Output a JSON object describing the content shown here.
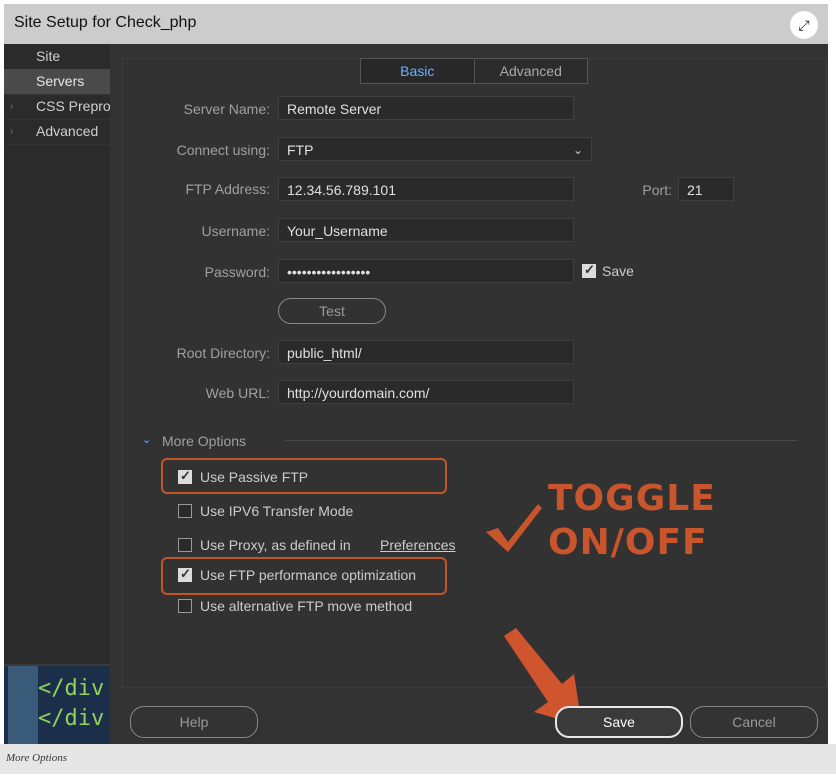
{
  "window": {
    "title": "Site Setup for Check_php"
  },
  "sidebar": {
    "items": [
      {
        "label": "Site",
        "active": false,
        "expandable": false
      },
      {
        "label": "Servers",
        "active": true,
        "expandable": false
      },
      {
        "label": "CSS Prepro",
        "active": false,
        "expandable": true
      },
      {
        "label": "Advanced",
        "active": false,
        "expandable": true
      }
    ]
  },
  "code_preview": {
    "lines": [
      "</div",
      "</div"
    ]
  },
  "tabs": [
    {
      "label": "Basic",
      "active": true
    },
    {
      "label": "Advanced",
      "active": false
    }
  ],
  "form": {
    "server_name": {
      "label": "Server Name:",
      "value": "Remote Server"
    },
    "connect_using": {
      "label": "Connect using:",
      "value": "FTP"
    },
    "ftp_address": {
      "label": "FTP Address:",
      "value": "12.34.56.789.101"
    },
    "port": {
      "label": "Port:",
      "value": "21"
    },
    "username": {
      "label": "Username:",
      "value": "Your_Username"
    },
    "password": {
      "label": "Password:",
      "value": "•••••••••••••••••"
    },
    "save_password": {
      "label": "Save",
      "checked": true
    },
    "test_button": "Test",
    "root_directory": {
      "label": "Root Directory:",
      "value": "public_html/"
    },
    "web_url": {
      "label": "Web URL:",
      "value": "http://yourdomain.com/"
    }
  },
  "more_options": {
    "label": "More Options",
    "options": [
      {
        "label": "Use Passive FTP",
        "checked": true,
        "highlighted": true
      },
      {
        "label": "Use IPV6 Transfer Mode",
        "checked": false,
        "highlighted": false
      },
      {
        "label": "Use Proxy, as defined in",
        "checked": false,
        "highlighted": false,
        "link": "Preferences"
      },
      {
        "label": "Use FTP performance optimization",
        "checked": true,
        "highlighted": true
      },
      {
        "label": "Use alternative FTP move method",
        "checked": false,
        "highlighted": false
      }
    ]
  },
  "annotation": {
    "line1": "TOGGLE",
    "line2": "ON/OFF",
    "color": "#c8552c"
  },
  "buttons": {
    "help": "Help",
    "save": "Save",
    "cancel": "Cancel"
  },
  "caption": "More Options",
  "colors": {
    "accent_blue": "#6ab0ff",
    "annotation_orange": "#c8552c",
    "dialog_bg": "#323232"
  }
}
